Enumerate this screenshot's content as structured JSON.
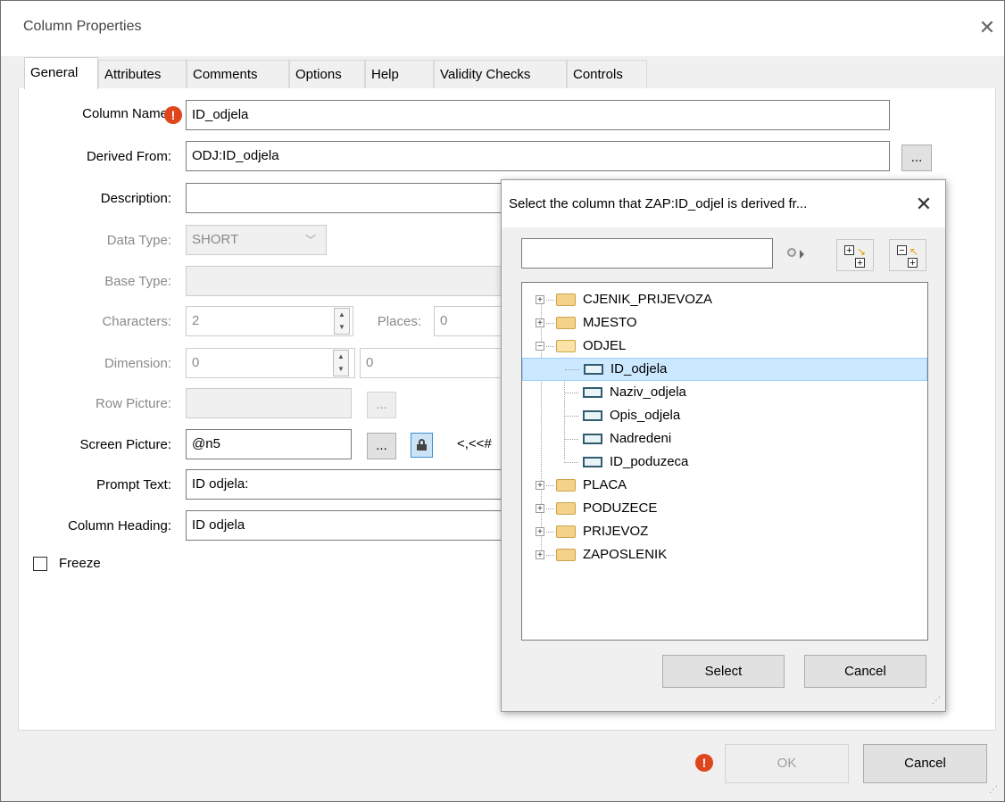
{
  "window": {
    "title": "Column Properties"
  },
  "tabs": [
    "General",
    "Attributes",
    "Comments",
    "Options",
    "Help",
    "Validity Checks",
    "Controls"
  ],
  "form": {
    "column_name_label": "Column Name",
    "column_name_value": "ID_odjela",
    "derived_from_label": "Derived From:",
    "derived_from_value": "ODJ:ID_odjela",
    "description_label": "Description:",
    "description_value": "",
    "data_type_label": "Data Type:",
    "data_type_value": "SHORT",
    "base_type_label": "Base Type:",
    "characters_label": "Characters:",
    "characters_value": "2",
    "places_label": "Places:",
    "places_value": "0",
    "dimension_label": "Dimension:",
    "dimension_value": "0",
    "dimension_value2": "0",
    "row_picture_label": "Row Picture:",
    "screen_picture_label": "Screen Picture:",
    "screen_picture_value": "@n5",
    "screen_picture_extra": "<,<<#",
    "prompt_text_label": "Prompt Text:",
    "prompt_text_value": "ID odjela:",
    "column_heading_label": "Column Heading:",
    "column_heading_value": "ID odjela",
    "freeze_label": "Freeze",
    "ellipsis": "..."
  },
  "footer": {
    "ok": "OK",
    "cancel": "Cancel"
  },
  "dialog": {
    "title": "Select the column that ZAP:ID_odjel is derived fr...",
    "search_value": "",
    "select": "Select",
    "cancel": "Cancel",
    "tree": [
      {
        "label": "CJENIK_PRIJEVOZA",
        "type": "folder",
        "level": 0,
        "expander": "+"
      },
      {
        "label": "MJESTO",
        "type": "folder",
        "level": 0,
        "expander": "+"
      },
      {
        "label": "ODJEL",
        "type": "folder-open",
        "level": 0,
        "expander": "-"
      },
      {
        "label": "ID_odjela",
        "type": "column",
        "level": 1,
        "selected": true
      },
      {
        "label": "Naziv_odjela",
        "type": "column",
        "level": 1
      },
      {
        "label": "Opis_odjela",
        "type": "column",
        "level": 1
      },
      {
        "label": "Nadredeni",
        "type": "column",
        "level": 1
      },
      {
        "label": "ID_poduzeca",
        "type": "column",
        "level": 1
      },
      {
        "label": "PLACA",
        "type": "folder",
        "level": 0,
        "expander": "+"
      },
      {
        "label": "PODUZECE",
        "type": "folder",
        "level": 0,
        "expander": "+"
      },
      {
        "label": "PRIJEVOZ",
        "type": "folder",
        "level": 0,
        "expander": "+"
      },
      {
        "label": "ZAPOSLENIK",
        "type": "folder",
        "level": 0,
        "expander": "+"
      }
    ]
  },
  "colors": {
    "selection": "#cce8ff",
    "selection_border": "#99d1ff",
    "error": "#e0461d"
  }
}
